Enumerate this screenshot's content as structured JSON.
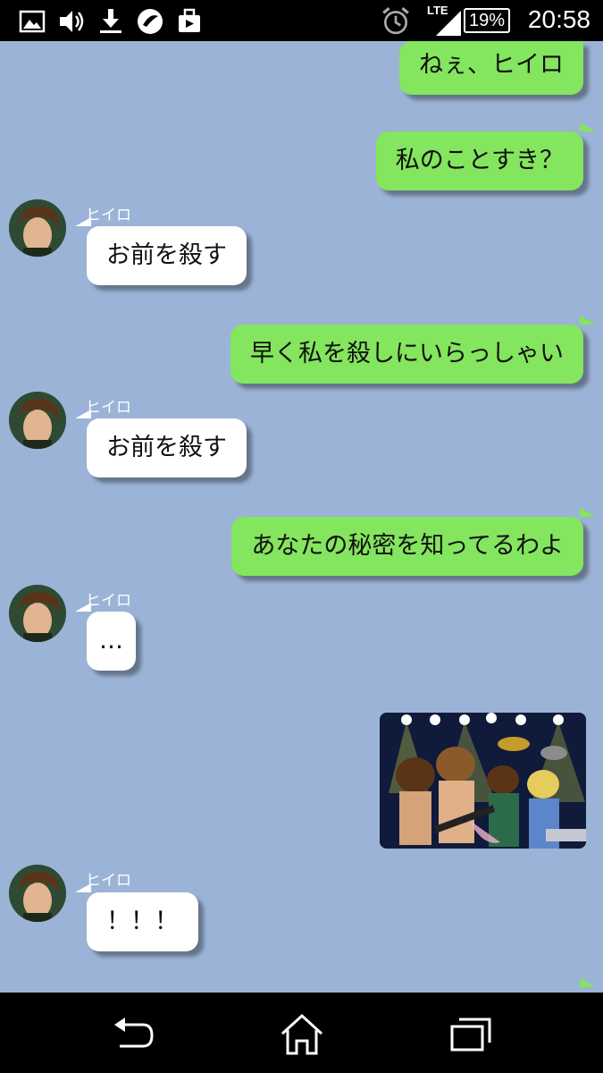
{
  "status_bar": {
    "network": "LTE",
    "battery": "19%",
    "time": "20:58",
    "icons": [
      "gallery-icon",
      "volume-icon",
      "download-icon",
      "app-icon",
      "bag-icon",
      "alarm-icon",
      "signal-icon"
    ]
  },
  "chat": {
    "sender_name": "ヒイロ",
    "messages": [
      {
        "side": "out",
        "text": "ねぇ、ヒイロ"
      },
      {
        "side": "out",
        "text": "私のことすき？"
      },
      {
        "side": "in",
        "sender": "ヒイロ",
        "text": "お前を殺す"
      },
      {
        "side": "out",
        "text": "早く私を殺しにいらっしゃい"
      },
      {
        "side": "in",
        "sender": "ヒイロ",
        "text": "お前を殺す"
      },
      {
        "side": "out",
        "text": "あなたの秘密を知ってるわよ"
      },
      {
        "side": "in",
        "sender": "ヒイロ",
        "text": "…"
      },
      {
        "side": "out",
        "type": "image",
        "description_icon": "photo-icon"
      },
      {
        "side": "in",
        "sender": "ヒイロ",
        "text": "！！！"
      }
    ]
  },
  "colors": {
    "chat_background": "#9bb3d6",
    "outgoing_bubble": "#84e55e",
    "incoming_bubble": "#ffffff"
  },
  "nav_bar": {
    "icons": [
      "back-icon",
      "home-icon",
      "recents-icon"
    ]
  }
}
